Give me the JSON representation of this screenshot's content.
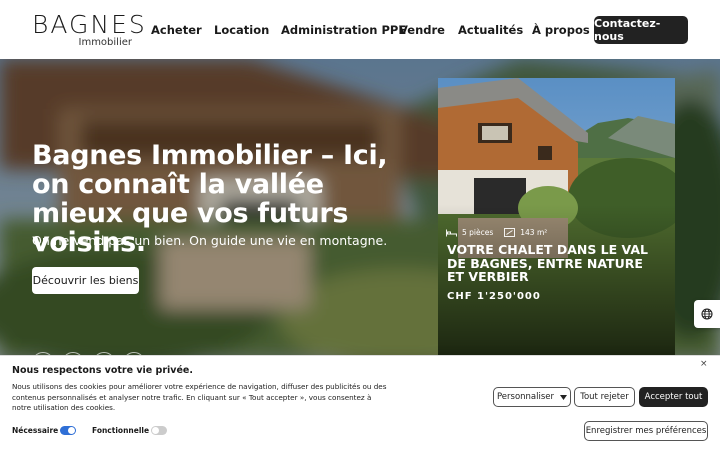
{
  "header": {
    "logo_main": "BAGNES",
    "logo_sub": "Immobilier",
    "nav": [
      {
        "label": "Acheter"
      },
      {
        "label": "Location"
      },
      {
        "label": "Administration PPE"
      },
      {
        "label": "Vendre"
      },
      {
        "label": "Actualités"
      },
      {
        "label": "À propos"
      }
    ],
    "cta": "Contactez-nous"
  },
  "hero": {
    "title": "Bagnes Immobilier – Ici, on connaît la vallée mieux que vos futurs voisins.",
    "subtitle": "On ne vend pas un bien. On guide une vie en montagne.",
    "button": "Découvrir les biens"
  },
  "card": {
    "rooms": "5 pièces",
    "area": "143 m²",
    "title": "Votre chalet dans le Val de Bagnes, entre nature et Verbier",
    "extra": "CHF 1'250'000"
  },
  "cookie": {
    "title": "Nous respectons votre vie privée.",
    "text": "Nous utilisons des cookies pour améliorer votre expérience de navigation, diffuser des publicités ou des contenus personnalisés et analyser notre trafic. En cliquant sur « Tout accepter », vous consentez à notre utilisation des cookies.",
    "customize": "Personnaliser",
    "reject": "Tout rejeter",
    "accept": "Accepter tout",
    "save": "Enregistrer mes préférences",
    "necessary": "Nécessaire",
    "functional": "Fonctionnelle",
    "close": "×"
  },
  "colors": {
    "accent": "#222222",
    "toggle_on": "#2f6fd6",
    "toggle_off": "#cccccc"
  }
}
